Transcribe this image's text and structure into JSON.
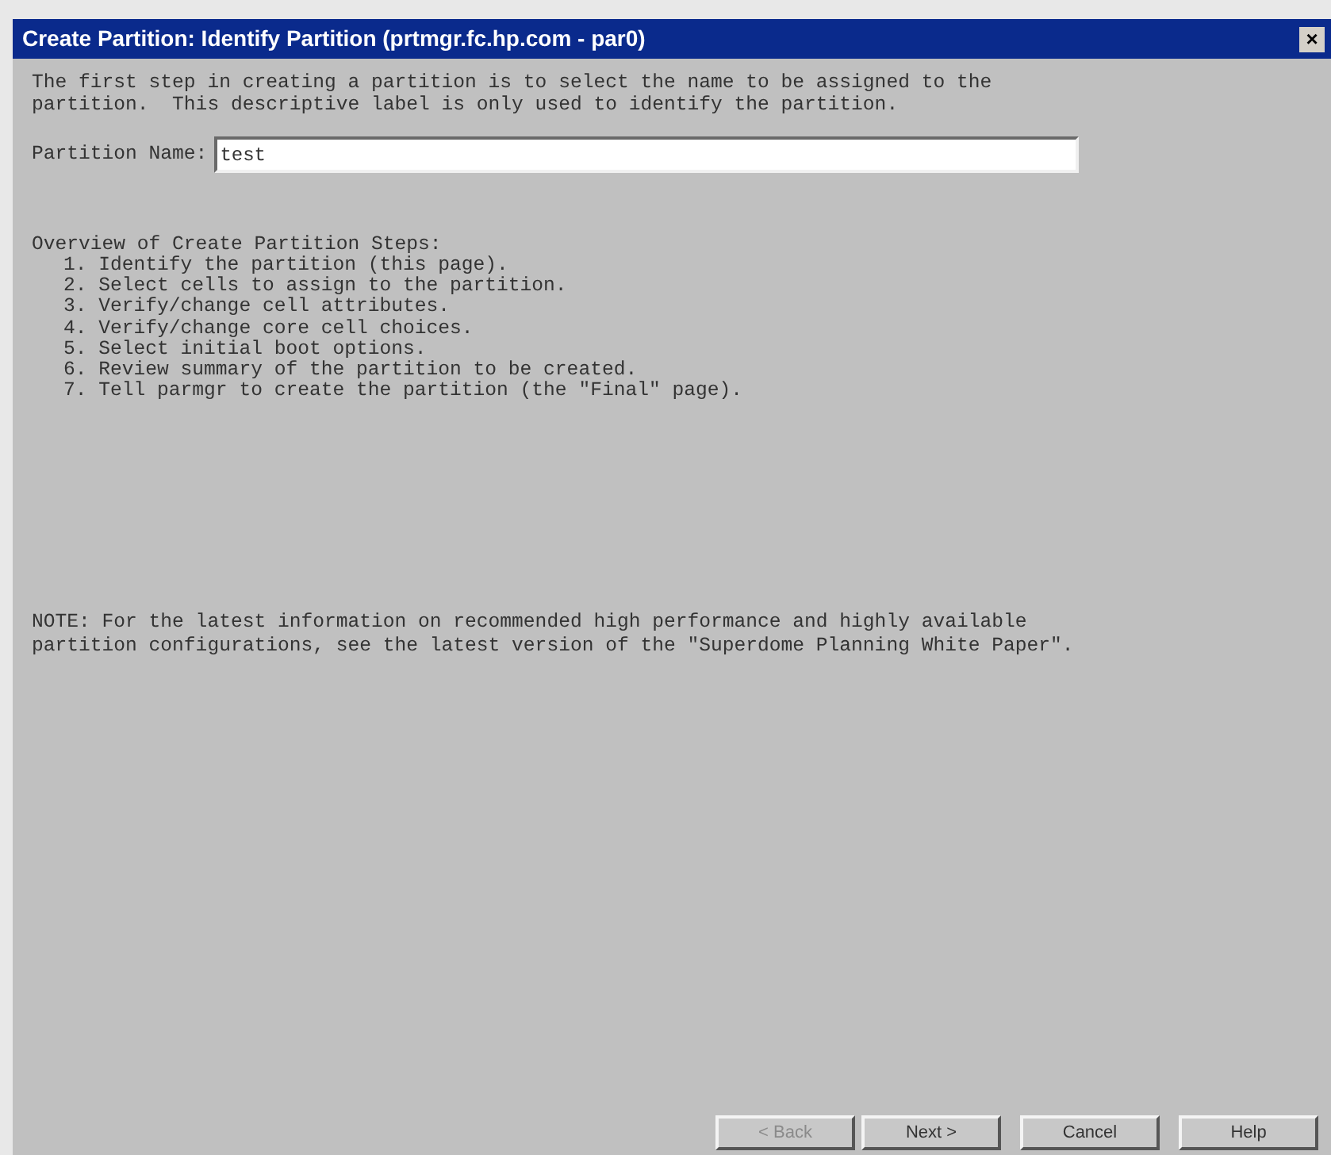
{
  "window": {
    "title": "Create Partition: Identify Partition (prtmgr.fc.hp.com - par0)",
    "close": "×"
  },
  "intro": [
    "The first step in creating a partition is to select the name to be assigned to the",
    "partition.  This descriptive label is only used to identify the partition."
  ],
  "name_field": {
    "label": "Partition Name:",
    "value": "test"
  },
  "overview": {
    "heading": "Overview of Create Partition Steps:",
    "steps": [
      "1. Identify the partition (this page).",
      "2. Select cells to assign to the partition.",
      "3. Verify/change cell attributes.",
      "4. Verify/change core cell choices.",
      "5. Select initial boot options.",
      "6. Review summary of the partition to be created.",
      "7. Tell parmgr to create the partition (the \"Final\" page)."
    ]
  },
  "note": [
    "NOTE: For the latest information on recommended high performance and highly available",
    "partition configurations, see the latest version of the \"Superdome Planning White Paper\"."
  ],
  "buttons": [
    {
      "label": "< Back",
      "disabled": true
    },
    {
      "label": "Next >",
      "disabled": false
    },
    {
      "label": "Cancel",
      "disabled": false
    },
    {
      "label": "Help",
      "disabled": false
    }
  ]
}
